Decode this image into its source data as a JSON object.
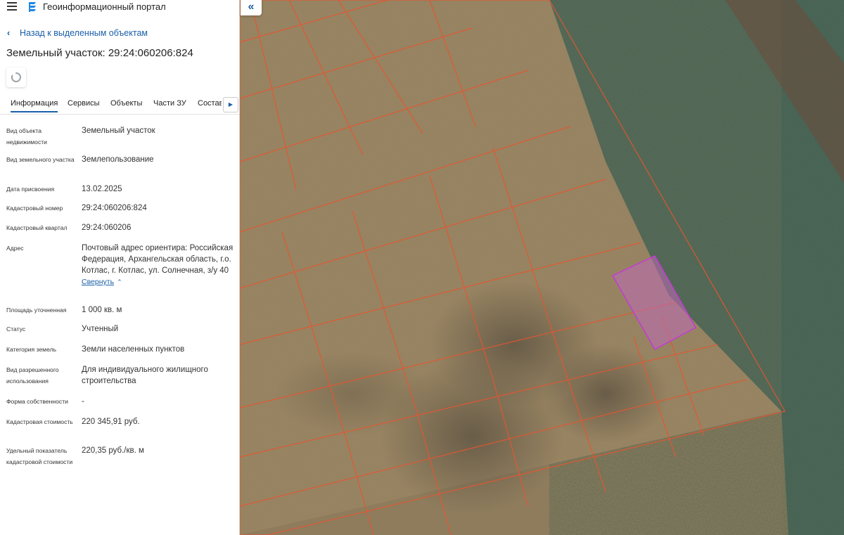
{
  "header": {
    "app_title": "Геоинформационный портал",
    "menu_icon": "hamburger-menu-icon",
    "logo_icon": "portal-logo-icon"
  },
  "navigation": {
    "back_label": "Назад к выделенным объектам",
    "back_icon": "chevron-left-icon"
  },
  "object": {
    "title": "Земельный участок: 29:24:060206:824"
  },
  "tabs": [
    {
      "label": "Информация",
      "active": true
    },
    {
      "label": "Сервисы",
      "active": false
    },
    {
      "label": "Объекты",
      "active": false
    },
    {
      "label": "Части ЗУ",
      "active": false
    },
    {
      "label": "Состав",
      "active": false
    }
  ],
  "properties": [
    {
      "label": "Вид объекта недвижимости",
      "value": "Земельный участок"
    },
    {
      "label": "Вид земельного участка",
      "value": "Землепользование"
    },
    {
      "label": "Дата присвоения",
      "value": "13.02.2025"
    },
    {
      "label": "Кадастровый номер",
      "value": "29:24:060206:824"
    },
    {
      "label": "Кадастровый квартал",
      "value": "29:24:060206"
    },
    {
      "label": "Адрес",
      "value": "Почтовый адрес ориентира: Российская Федерация, Архангельская область, г.о. Котлас, г. Котлас, ул. Солнечная, з/у 40"
    },
    {
      "label": "Площадь уточненная",
      "value": "1 000 кв. м"
    },
    {
      "label": "Статус",
      "value": "Учтенный"
    },
    {
      "label": "Категория земель",
      "value": "Земли населенных пунктов"
    },
    {
      "label": "Вид разрешенного использования",
      "value": "Для индивидуального жилищного строительства"
    },
    {
      "label": "Форма собственности",
      "value": "-"
    },
    {
      "label": "Кадастровая стоимость",
      "value": "220 345,91 руб."
    },
    {
      "label": "Удельный показатель кадастровой стоимости",
      "value": "220,35 руб./кв. м"
    }
  ],
  "address_collapse_label": "Свернуть",
  "colors": {
    "accent": "#1a5fa8",
    "parcel_border": "#e8552f",
    "selected_parcel": "#c23bd4"
  }
}
